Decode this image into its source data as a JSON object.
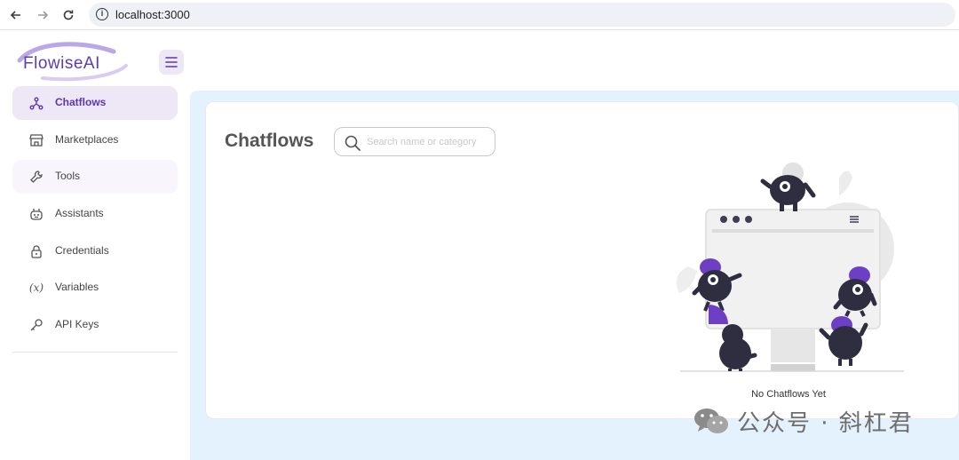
{
  "browser": {
    "back_icon": "arrow-left-icon",
    "forward_icon": "arrow-right-icon",
    "reload_icon": "reload-icon",
    "url": "localhost:3000"
  },
  "header": {
    "logo_text": "FlowiseAI",
    "menu_icon": "hamburger-menu-icon"
  },
  "sidebar": {
    "items": [
      {
        "label": "Chatflows",
        "icon": "chatflows-icon",
        "active": true
      },
      {
        "label": "Marketplaces",
        "icon": "store-icon",
        "active": false
      },
      {
        "label": "Tools",
        "icon": "tools-icon",
        "active": false
      },
      {
        "label": "Assistants",
        "icon": "robot-icon",
        "active": false
      },
      {
        "label": "Credentials",
        "icon": "lock-icon",
        "active": false
      },
      {
        "label": "Variables",
        "icon": "variable-icon",
        "active": false
      },
      {
        "label": "API Keys",
        "icon": "key-icon",
        "active": false
      }
    ]
  },
  "main": {
    "title": "Chatflows",
    "search": {
      "placeholder": "Search name or category",
      "value": ""
    },
    "empty_text": "No Chatflows Yet"
  },
  "watermark": {
    "text": "公众号 · 斜杠君"
  },
  "colors": {
    "accent": "#5e35b1",
    "accent_light": "#ede7f6",
    "main_bg": "#e3f2fd"
  }
}
